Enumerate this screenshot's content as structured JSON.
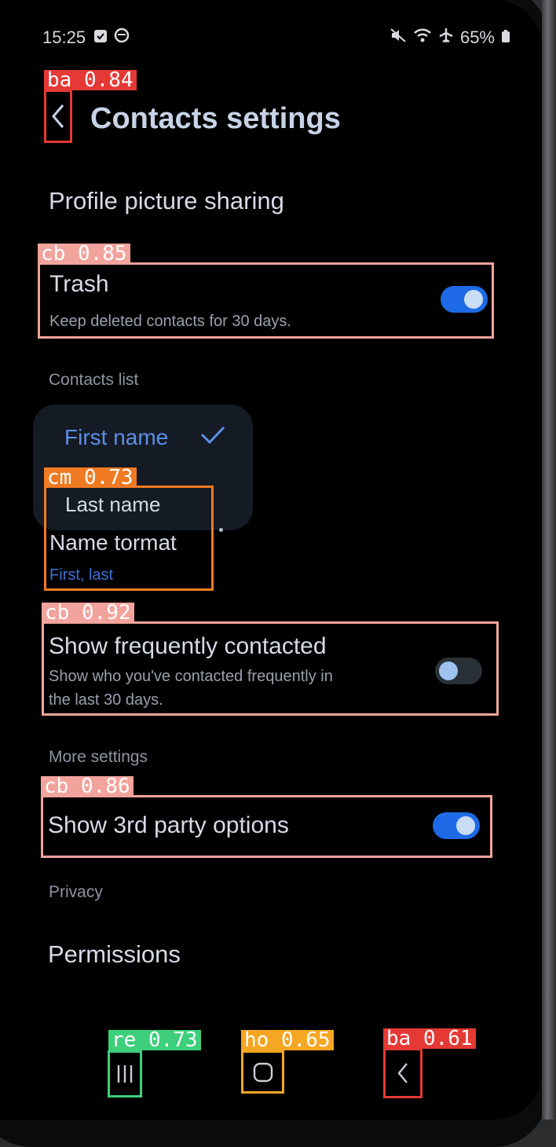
{
  "status_bar": {
    "time": "15:25",
    "battery": "65%"
  },
  "header": {
    "title": "Contacts settings",
    "back_tag": "ba 0.84"
  },
  "items": {
    "profile_picture_sharing": "Profile picture sharing",
    "trash_title": "Trash",
    "trash_subtitle": "Keep deleted contacts for 30 days.",
    "trash_tag": "cb 0.85",
    "contacts_list_section": "Contacts list",
    "name_format_title": "Name tormat",
    "name_format_value": "First, last",
    "name_format_tag": "cm 0.73",
    "frequent_title": "Show frequently contacted",
    "frequent_subtitle_1": "Show who you've contacted frequently in",
    "frequent_subtitle_2": "the last 30 days.",
    "frequent_tag": "cb 0.92",
    "more_settings_section": "More settings",
    "third_party_title": "Show 3rd party options",
    "third_party_tag": "cb 0.86",
    "privacy_section": "Privacy",
    "permissions": "Permissions"
  },
  "toggles": {
    "trash": true,
    "frequent": false,
    "third_party": true
  },
  "popup": {
    "options": [
      "First name",
      "Last name"
    ],
    "selected": "First name"
  },
  "nav": {
    "recents_tag": "re 0.73",
    "home_tag": "ho 0.65",
    "back_tag": "ba 0.61"
  },
  "colors": {
    "accent_blue": "#1e6ae6",
    "tag_red": "#e53935",
    "tag_pink": "#f2a39c",
    "tag_orange": "#f07a22",
    "tag_green": "#3ecf7c",
    "tag_yellow": "#f5a623"
  }
}
